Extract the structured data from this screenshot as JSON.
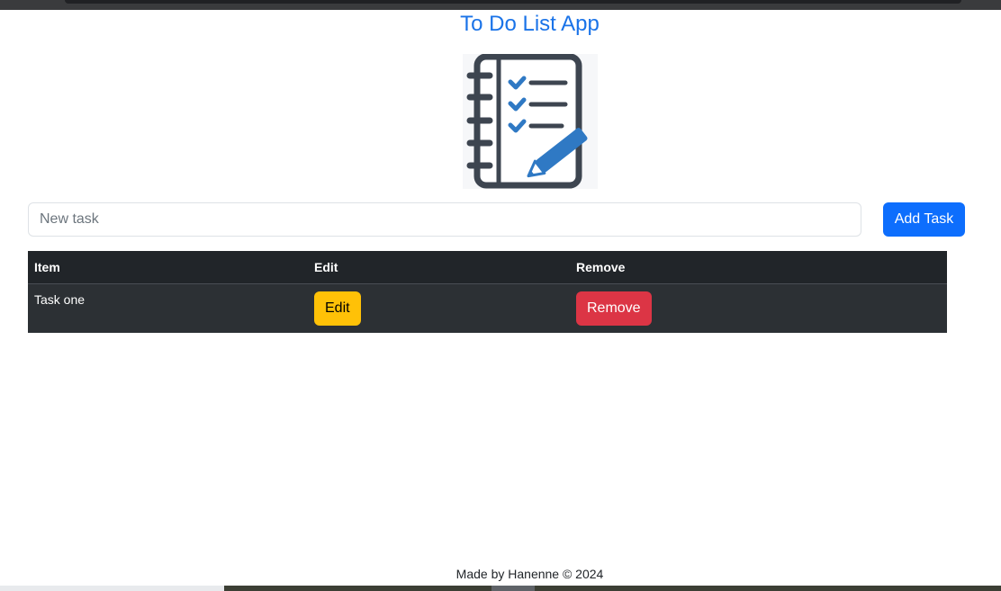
{
  "app": {
    "title": "To Do List App",
    "logo_icon": "notebook-checklist-pencil-icon"
  },
  "form": {
    "placeholder": "New task",
    "value": "",
    "add_label": "Add Task"
  },
  "table": {
    "headers": [
      "Item",
      "Edit",
      "Remove"
    ],
    "rows": [
      {
        "item": "Task one",
        "edit_label": "Edit",
        "remove_label": "Remove"
      }
    ]
  },
  "footer": {
    "text": "Made by Hanenne © 2024"
  },
  "colors": {
    "title": "#1a73e8",
    "primary": "#0d6efd",
    "warning": "#ffc107",
    "danger": "#dc3545",
    "table_dark": "#212529",
    "icon_dark": "#3d4550",
    "icon_blue": "#2f79c4"
  }
}
